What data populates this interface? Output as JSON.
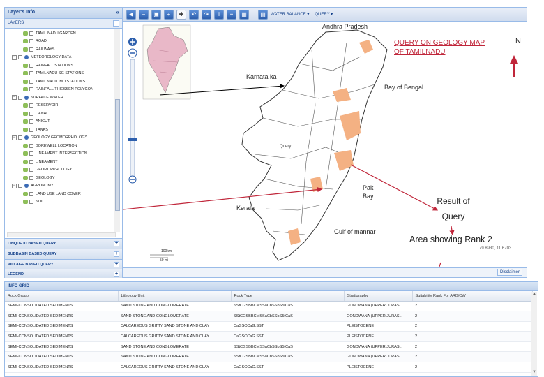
{
  "left_panel": {
    "title": "Layer's Info",
    "collapse_icon": "double-chevron-left",
    "layers_label": "LAYERS",
    "tree": [
      {
        "kind": "child",
        "label": "TAMIL NADU GARDEN"
      },
      {
        "kind": "child",
        "label": "ROAD"
      },
      {
        "kind": "child",
        "label": "RAILWAYS"
      },
      {
        "kind": "group",
        "label": "METEOROLOGY DATA"
      },
      {
        "kind": "child",
        "label": "RAINFALL STATIONS"
      },
      {
        "kind": "child",
        "label": "TAMILNADU SG STATIONS"
      },
      {
        "kind": "child",
        "label": "TAMILNADU IMD STATIONS"
      },
      {
        "kind": "child",
        "label": "RAINFALL THIESSEN POLYGON"
      },
      {
        "kind": "group",
        "label": "SURFACE WATER"
      },
      {
        "kind": "child",
        "label": "RESERVOIR"
      },
      {
        "kind": "child",
        "label": "CANAL"
      },
      {
        "kind": "child",
        "label": "ANICUT"
      },
      {
        "kind": "child",
        "label": "TANKS"
      },
      {
        "kind": "group",
        "label": "GEOLOGY GEOMORPHOLOGY"
      },
      {
        "kind": "child",
        "label": "BOREWELL LOCATION"
      },
      {
        "kind": "child",
        "label": "LINEAMENT INTERSECTION"
      },
      {
        "kind": "child",
        "label": "LINEAMENT"
      },
      {
        "kind": "child",
        "label": "GEOMORPHOLOGY"
      },
      {
        "kind": "child",
        "label": "GEOLOGY"
      },
      {
        "kind": "group",
        "label": "AGRONOMY"
      },
      {
        "kind": "child",
        "label": "LAND USE LAND COVER"
      },
      {
        "kind": "child",
        "label": "SOIL"
      }
    ],
    "accordions": [
      "LINQUE ID BASED QUERY",
      "SUBBASIN BASED QUERY",
      "VILLAGE BASED QUERY",
      "LEGEND"
    ]
  },
  "toolbar": {
    "menus": [
      "WATER BALANCE",
      "QUERY"
    ]
  },
  "map": {
    "state_labels": [
      "Andhra Pradesh",
      "Karnata ka",
      "Kerala"
    ],
    "sea_labels": [
      "Bay of Bengal",
      "Pak Bay",
      "Gulf of mannar"
    ],
    "query_title": "QUERY ON GEOLOGY MAP OF  TAMILNADU",
    "north": "N",
    "result_label": "Result of Query",
    "area_label": "Area showing Rank 2",
    "scale_top": "100km",
    "scale_bottom": "50 mi",
    "coords": "79.8930, 11.6703",
    "district_label": "Query",
    "inset_map_name": "India location map",
    "disclaimer": "Disclaimer",
    "colors": {
      "highlight": "#f4b183",
      "annotation_red": "#c0263a",
      "accent": "#15428b"
    }
  },
  "info_grid": {
    "title": "INFO GRID",
    "columns": [
      "Rock Group",
      "Lithology Unit",
      "Rock Type",
      "Stratigraphy",
      "Suitability Rank For ARB/CW"
    ],
    "rows": [
      [
        "SEMI-CONSOLIDATED SEDIMENTS",
        "SAND STONE AND CONGLOMERATE",
        "SStCGSBBCMSSaCbSSbS5tCaS",
        "GONDWANA (UPPER JURAS...",
        "2"
      ],
      [
        "SEMI-CONSOLIDATED SEDIMENTS",
        "SAND STONE AND CONGLOMERATE",
        "SStCGSBBCMSSaCbSSbS5tCaS",
        "GONDWANA (UPPER JURAS...",
        "2"
      ],
      [
        "SEMI-CONSOLIDATED SEDIMENTS",
        "CALCAREOUS GRITTY SAND STONE AND CLAY",
        "CaGSCCaG.SST",
        "PLEISTOCENE",
        "2"
      ],
      [
        "SEMI-CONSOLIDATED SEDIMENTS",
        "CALCAREOUS GRITTY SAND STONE AND CLAY",
        "CaGSCCaG.SST",
        "PLEISTOCENE",
        "2"
      ],
      [
        "SEMI-CONSOLIDATED SEDIMENTS",
        "SAND STONE AND CONGLOMERATE",
        "SStCGSBBCMSSaCbSSbS5tCaS",
        "GONDWANA (UPPER JURAS...",
        "2"
      ],
      [
        "SEMI-CONSOLIDATED SEDIMENTS",
        "SAND STONE AND CONGLOMERATE",
        "SStCGSBBCMSSaCbSSbS5tCaS",
        "GONDWANA (UPPER JURAS...",
        "2"
      ],
      [
        "SEMI-CONSOLIDATED SEDIMENTS",
        "CALCAREOUS GRITTY SAND STONE AND CLAY",
        "CaGSCCaG.SST",
        "PLEISTOCENE",
        "2"
      ]
    ]
  }
}
